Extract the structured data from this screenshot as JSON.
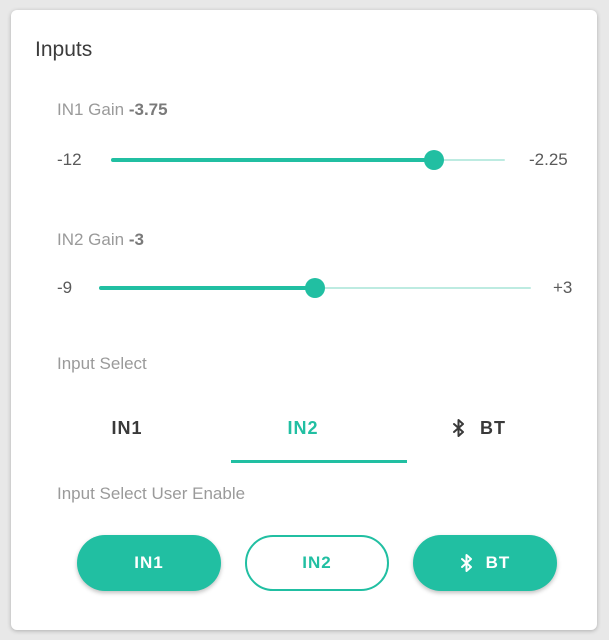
{
  "card": {
    "title": "Inputs"
  },
  "in1_gain": {
    "label": "IN1 Gain",
    "value": "-3.75",
    "min_label": "-12",
    "max_label": "-2.25",
    "fraction": 0.82
  },
  "in2_gain": {
    "label": "IN2 Gain",
    "value": "-3",
    "min_label": "-9",
    "max_label": "+3",
    "fraction": 0.5
  },
  "input_select": {
    "label": "Input Select",
    "tabs": [
      {
        "label": "IN1",
        "icon": null
      },
      {
        "label": "IN2",
        "icon": null
      },
      {
        "label": "BT",
        "icon": "bluetooth-icon"
      }
    ],
    "selected": "IN2"
  },
  "input_select_user_enable": {
    "label": "Input Select User Enable",
    "buttons": [
      {
        "label": "IN1",
        "icon": null,
        "enabled": true
      },
      {
        "label": "IN2",
        "icon": null,
        "enabled": false
      },
      {
        "label": "BT",
        "icon": "bluetooth-icon",
        "enabled": true
      }
    ]
  },
  "colors": {
    "accent": "#21bfa2",
    "track_inactive": "#bdebe1",
    "pill_off_bg": "#ffffff"
  }
}
